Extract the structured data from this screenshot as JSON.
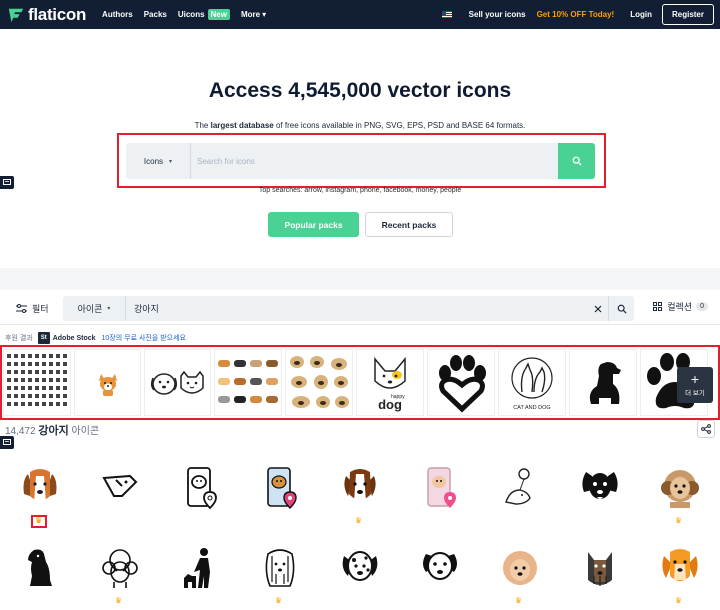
{
  "header": {
    "logo_text": "flaticon",
    "nav": [
      {
        "label": "Authors"
      },
      {
        "label": "Packs"
      },
      {
        "label": "Uicons",
        "badge": "New"
      },
      {
        "label": "More"
      }
    ],
    "sell": "Sell your icons",
    "promo": "Get 10% OFF Today!",
    "login": "Login",
    "register": "Register"
  },
  "hero": {
    "title": "Access 4,545,000 vector icons",
    "subtitle_pre": "The ",
    "subtitle_bold": "largest database",
    "subtitle_post": " of free icons available in PNG, SVG, EPS, PSD and BASE 64 formats.",
    "search_type": "Icons",
    "search_placeholder": "Search for icons",
    "top_searches": "Top searches: arrow, instagram, phone, facebook, money, people",
    "popular_packs": "Popular packs",
    "recent_packs": "Recent packs"
  },
  "filterbar": {
    "filter": "필터",
    "type": "아이콘",
    "query": "강아지",
    "collection": "컬렉션",
    "collection_count": "0"
  },
  "sponsored": {
    "label": "후원 결과",
    "st": "St",
    "brand": "Adobe Stock",
    "link": "10장의 무료 사진을 받으세요",
    "more": "더 보기",
    "tiles": [
      "icon-sheet-image",
      "corgi-image",
      "dog-cat-faces-image",
      "dog-breeds-image",
      "pugs-image",
      "happy-dog-image",
      "paw-heart-image",
      "cat-and-dog-image",
      "dog-silhouette-image",
      "paw-print-image"
    ],
    "tile_texts": {
      "happy_small": "happy",
      "happy_big": "dog",
      "cat_and_dog": "CAT AND DOG"
    }
  },
  "results": {
    "count": "14,472",
    "query": "강아지",
    "suffix": "아이콘"
  },
  "grid": {
    "row1": [
      "beagle-icon",
      "line-dog-icon",
      "dog-gps-phone-icon",
      "dog-location-phone-icon",
      "bernese-dog-icon",
      "dog-app-phone-icon",
      "dog-balloon-icon",
      "black-dog-face-icon",
      "shih-tzu-icon"
    ],
    "row2": [
      "sitting-dog-icon",
      "poodle-line-icon",
      "person-dog-icon",
      "long-hair-dog-icon",
      "spotted-dog-icon",
      "dog-face-outline-icon",
      "curly-dog-icon",
      "yorkie-icon",
      "orange-dog-icon"
    ],
    "premium_row1": [
      true,
      false,
      false,
      false,
      true,
      false,
      false,
      false,
      true
    ],
    "premium_row2": [
      false,
      true,
      false,
      true,
      false,
      false,
      true,
      false,
      true
    ]
  },
  "colors": {
    "brand_dark": "#111e33",
    "accent_green": "#4ad295",
    "promo_orange": "#fe9e00",
    "highlight_red": "#e0202e"
  }
}
